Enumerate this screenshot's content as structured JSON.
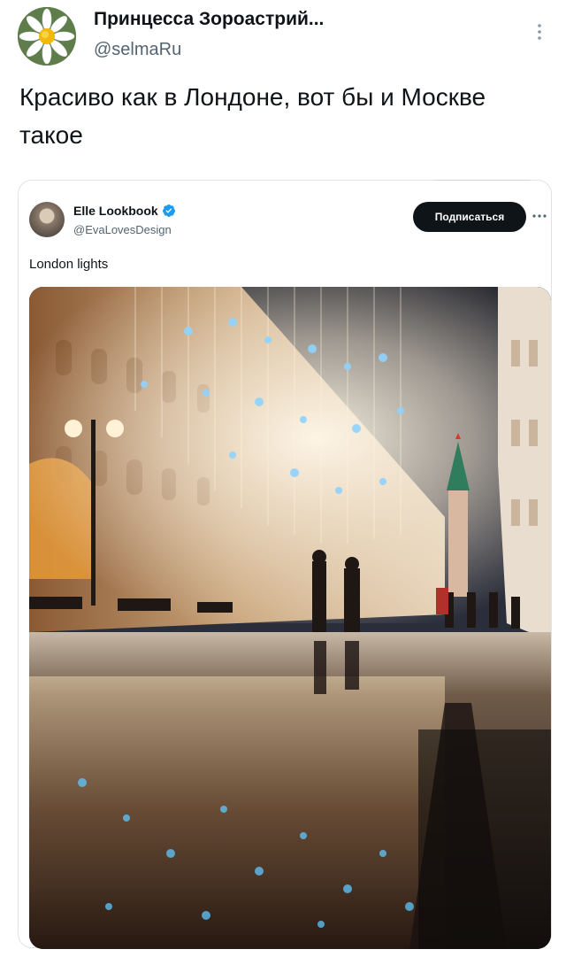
{
  "tweet": {
    "author_name": "Принцесса Зороастрий...",
    "author_handle": "@selmaRu",
    "more_icon": "vertical-ellipsis",
    "text": "Красиво как в Лондоне, вот бы и Москве такое"
  },
  "quoted": {
    "author_name": "Elle Lookbook",
    "author_handle": "@EvaLovesDesign",
    "verified": true,
    "follow_label": "Подписаться",
    "more_icon": "horizontal-ellipsis",
    "text": "London lights",
    "image_alt": "Nikolskaya street with hanging lights, reflected in wet pavement"
  },
  "colors": {
    "text_primary": "#0f1419",
    "text_secondary": "#536471",
    "verified_blue": "#1d9bf0",
    "follow_bg": "#0f1419"
  }
}
